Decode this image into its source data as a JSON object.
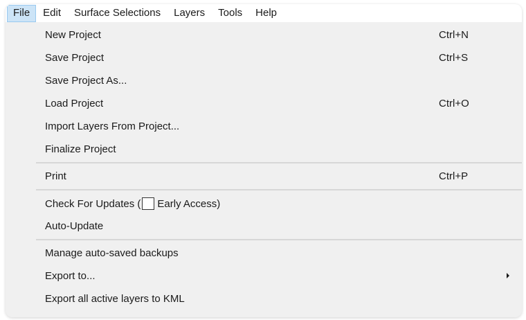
{
  "menubar": {
    "items": [
      {
        "label": "File",
        "active": true
      },
      {
        "label": "Edit"
      },
      {
        "label": "Surface Selections"
      },
      {
        "label": "Layers"
      },
      {
        "label": "Tools"
      },
      {
        "label": "Help"
      }
    ]
  },
  "file_menu": {
    "new_project": {
      "label": "New Project",
      "shortcut": "Ctrl+N"
    },
    "save_project": {
      "label": "Save Project",
      "shortcut": "Ctrl+S"
    },
    "save_project_as": {
      "label": "Save Project As..."
    },
    "load_project": {
      "label": "Load Project",
      "shortcut": "Ctrl+O"
    },
    "import_layers": {
      "label": "Import Layers From Project..."
    },
    "finalize_project": {
      "label": "Finalize Project"
    },
    "print": {
      "label": "Print",
      "shortcut": "Ctrl+P"
    },
    "check_updates": {
      "label_prefix": "Check For Updates (",
      "checkbox_label": "Early Access)",
      "checked": false
    },
    "auto_update": {
      "label": "Auto-Update"
    },
    "manage_backups": {
      "label": "Manage auto-saved backups"
    },
    "export_to": {
      "label": "Export to...",
      "icon": "chevron-right-icon"
    },
    "export_kml": {
      "label": "Export all active layers to KML"
    }
  }
}
